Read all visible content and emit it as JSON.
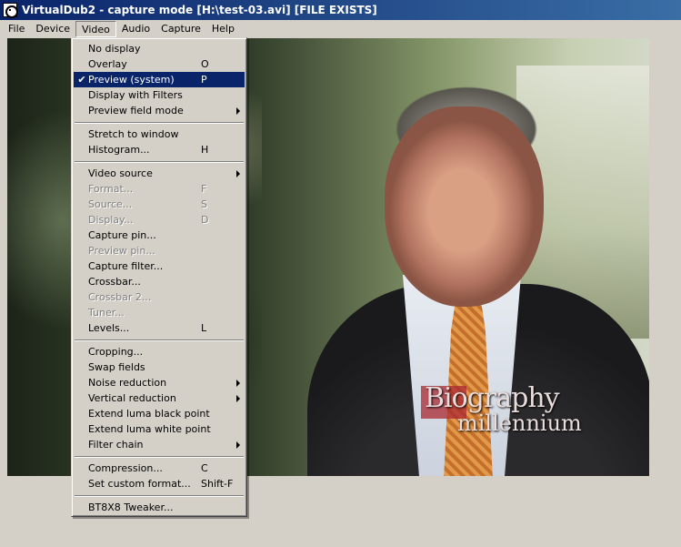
{
  "window": {
    "title": "VirtualDub2 - capture mode [H:\\test-03.avi] [FILE EXISTS]",
    "app_icon": "virtualdub-reel-icon"
  },
  "menubar": {
    "items": [
      "File",
      "Device",
      "Video",
      "Audio",
      "Capture",
      "Help"
    ],
    "open": "Video"
  },
  "video_caption": {
    "line1": "Biography",
    "line2": "millennium"
  },
  "video_menu": {
    "groups": [
      [
        {
          "label": "No display",
          "shortcut": ""
        },
        {
          "label": "Overlay",
          "shortcut": "O"
        },
        {
          "label": "Preview (system)",
          "shortcut": "P",
          "checked": true,
          "selected": true
        },
        {
          "label": "Display with Filters",
          "shortcut": ""
        },
        {
          "label": "Preview field mode",
          "shortcut": "",
          "submenu": true
        }
      ],
      [
        {
          "label": "Stretch to window",
          "shortcut": ""
        },
        {
          "label": "Histogram...",
          "shortcut": "H"
        }
      ],
      [
        {
          "label": "Video source",
          "shortcut": "",
          "submenu": true
        },
        {
          "label": "Format...",
          "shortcut": "F",
          "disabled": true
        },
        {
          "label": "Source...",
          "shortcut": "S",
          "disabled": true
        },
        {
          "label": "Display...",
          "shortcut": "D",
          "disabled": true
        },
        {
          "label": "Capture pin...",
          "shortcut": ""
        },
        {
          "label": "Preview pin...",
          "shortcut": "",
          "disabled": true
        },
        {
          "label": "Capture filter...",
          "shortcut": ""
        },
        {
          "label": "Crossbar...",
          "shortcut": ""
        },
        {
          "label": "Crossbar 2...",
          "shortcut": "",
          "disabled": true
        },
        {
          "label": "Tuner...",
          "shortcut": "",
          "disabled": true
        },
        {
          "label": "Levels...",
          "shortcut": "L"
        }
      ],
      [
        {
          "label": "Cropping...",
          "shortcut": ""
        },
        {
          "label": "Swap fields",
          "shortcut": ""
        },
        {
          "label": "Noise reduction",
          "shortcut": "",
          "submenu": true
        },
        {
          "label": "Vertical reduction",
          "shortcut": "",
          "submenu": true
        },
        {
          "label": "Extend luma black point",
          "shortcut": ""
        },
        {
          "label": "Extend luma white point",
          "shortcut": ""
        },
        {
          "label": "Filter chain",
          "shortcut": "",
          "submenu": true
        }
      ],
      [
        {
          "label": "Compression...",
          "shortcut": "C"
        },
        {
          "label": "Set custom format...",
          "shortcut": "Shift-F"
        }
      ],
      [
        {
          "label": "BT8X8 Tweaker...",
          "shortcut": ""
        }
      ]
    ]
  },
  "colors": {
    "titlebar_start": "#0a246a",
    "titlebar_end": "#3a6ea5",
    "menu_face": "#d4d0c8",
    "selection": "#0a246a"
  }
}
